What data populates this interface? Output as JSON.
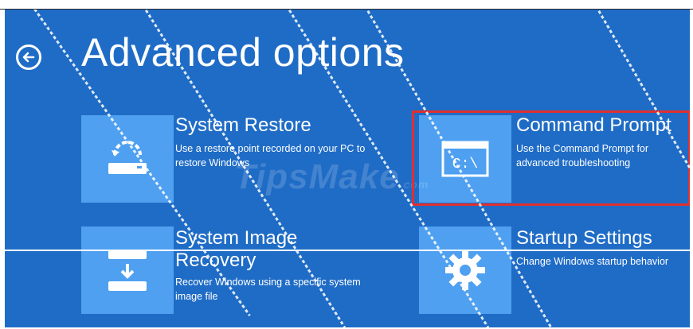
{
  "page": {
    "title": "Advanced options",
    "back_icon": "back-arrow-icon"
  },
  "options": [
    {
      "title": "System Restore",
      "description": "Use a restore point recorded on your PC to restore Windows",
      "icon": "system-restore-icon"
    },
    {
      "title": "Command Prompt",
      "description": "Use the Command Prompt for advanced troubleshooting",
      "icon": "command-prompt-icon",
      "icon_text": "C:\\"
    },
    {
      "title": "System Image Recovery",
      "title_line1": "System Image",
      "title_line2": "Recovery",
      "description": "Recover Windows using a specific system image file",
      "icon": "system-image-recovery-icon"
    },
    {
      "title": "Startup Settings",
      "description": "Change Windows startup behavior",
      "icon": "gear-icon"
    }
  ],
  "watermark": {
    "text": "TipsMake",
    "suffix": ".com"
  },
  "colors": {
    "background": "#1f6cc6",
    "tile": "#4fa0f0",
    "highlight": "#e03030"
  }
}
